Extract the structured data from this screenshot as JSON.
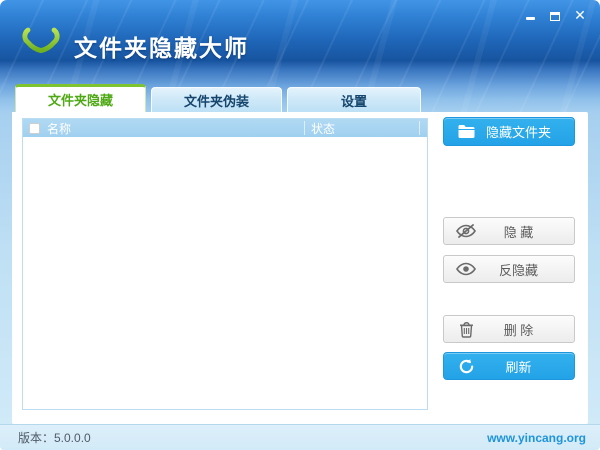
{
  "window": {
    "title": "文件夹隐藏大师",
    "controls": {
      "minimize": "minimize",
      "maximize": "maximize",
      "close": "✕"
    }
  },
  "tabs": [
    {
      "label": "文件夹隐藏",
      "active": true
    },
    {
      "label": "文件夹伪装",
      "active": false
    },
    {
      "label": "设置",
      "active": false
    }
  ],
  "list": {
    "columns": [
      {
        "label": "名称"
      },
      {
        "label": "状态"
      }
    ],
    "rows": [],
    "select_all_checked": false
  },
  "sidebar": {
    "hide_folder_button": "隐藏文件夹",
    "hide_button": "隐 藏",
    "unhide_button": "反隐藏",
    "delete_button": "删 除",
    "refresh_button": "刷新"
  },
  "statusbar": {
    "version": "版本：5.0.0.0",
    "website": "www.yincang.org"
  },
  "colors": {
    "titlebar_top": "#4295e6",
    "titlebar_bottom": "#17549f",
    "accent_blue": "#29a9ec",
    "logo_green": "#8dc63f",
    "active_tab_green": "#7fc32e",
    "active_tab_text": "#4fa915",
    "inactive_tab_text": "#16456e",
    "list_header_bg": "#a6d3f1",
    "status_bg": "#d8edf9",
    "website_link": "#1e94da"
  }
}
